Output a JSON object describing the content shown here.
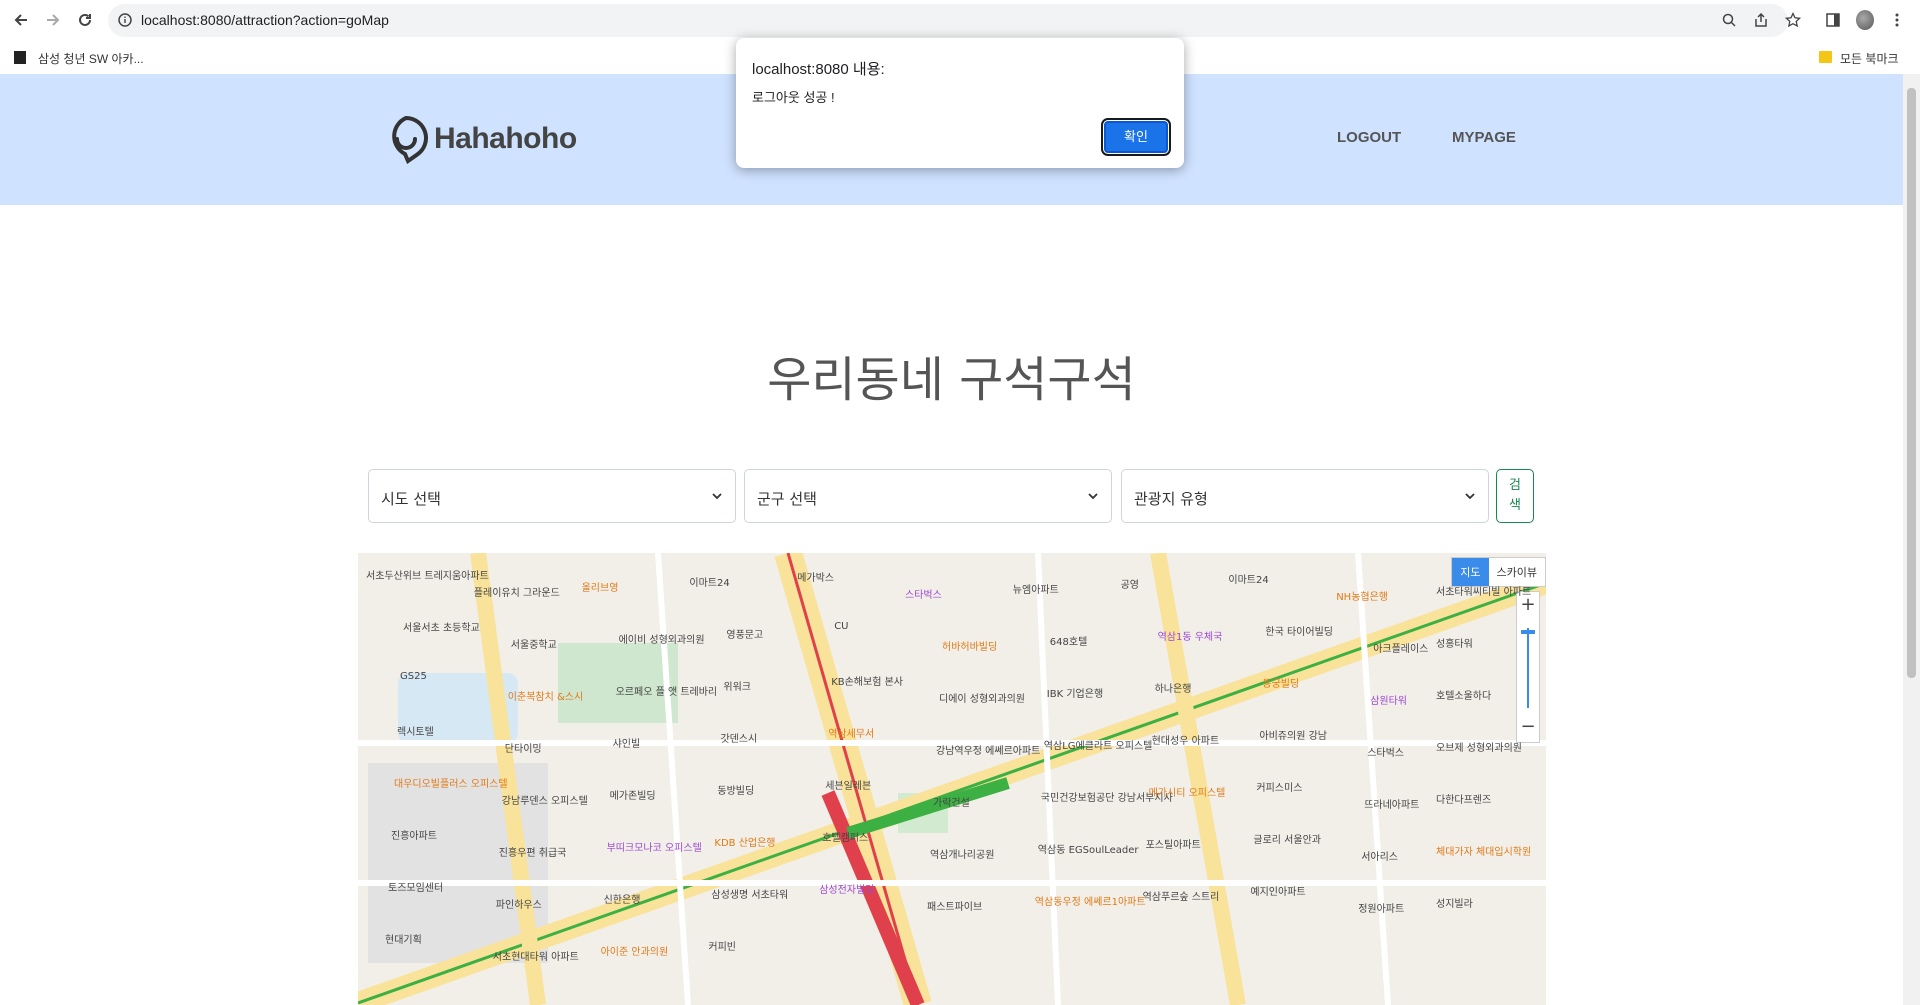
{
  "browser": {
    "url": "localhost:8080/attraction?action=goMap",
    "bookmark_left": "삼성 청년 SW 아카...",
    "bookmark_right": "모든 북마크"
  },
  "dialog": {
    "title": "localhost:8080 내용:",
    "message": "로그아웃 성공 !",
    "ok_label": "확인"
  },
  "header": {
    "logo_text": "Hahahoho",
    "menu": [
      "LOGOUT",
      "MYPAGE"
    ]
  },
  "main": {
    "title": "우리동네 구석구석",
    "filters": {
      "sido": "시도 선택",
      "gugun": "군구 선택",
      "type": "관광지 유형"
    },
    "search_label_1": "검",
    "search_label_2": "색"
  },
  "map": {
    "toggle": [
      "지도",
      "스카이뷰"
    ],
    "zoom_in": "+",
    "zoom_out": "−",
    "labels": [
      "서초두산위브 트레지움아파트",
      "플레이유치 그라운드",
      "올리브영",
      "이마트24",
      "메가박스",
      "스타벅스",
      "뉴엠아파트",
      "공영",
      "이마트24",
      "NH농협은행",
      "서초타워씨티빌 아파트",
      "서울서초 초등학교",
      "서울중학교",
      "에이비 성형외과의원",
      "영풍문고",
      "CU",
      "허바허바빌딩",
      "648호텔",
      "역삼1동 우체국",
      "한국 타이어빌딩",
      "아크플레이스",
      "성홍타워",
      "GS25",
      "이춘복참치 &스시",
      "오르페오 플 앳 트레바리",
      "위워크",
      "KB손해보험 본사",
      "디에이 성형외과의원",
      "IBK 기업은행",
      "하나은행",
      "동궁빌딩",
      "삼원타워",
      "호텔소울하다",
      "렉시토텔",
      "단타이밍",
      "샤인빌",
      "갓덴스시",
      "역삼세무서",
      "강남역우정 에쎄르아파트",
      "역삼LG에클라트 오피스텔",
      "현대성우 아파트",
      "아비쥬의원 강남",
      "스타벅스",
      "오브제 성형외과의원",
      "대우디오빌플러스 오피스텔",
      "강남루덴스 오피스텔",
      "메가존빌딩",
      "동방빌딩",
      "세븐일레븐",
      "가락건설",
      "국민건강보험공단 강남서부지사",
      "메가시티 오피스텔",
      "커피스미스",
      "뜨라네아파트",
      "다한다프렌즈",
      "진흥아파트",
      "진흥우편 취급국",
      "부띠크모나코 오피스텔",
      "KDB 산업은행",
      "호텔캠퍼스",
      "역삼개나리공원",
      "역삼동 EGSoulLeader",
      "포스틸아파트",
      "글로리 서울안과",
      "서아리스",
      "체대가자 체대입시학원",
      "토즈모임센터",
      "파인하우스",
      "신한은행",
      "삼성생명 서초타워",
      "삼성전자빌딩",
      "패스트파이브",
      "역삼동우정 에쎄르1아파트",
      "역삼푸르숲 스트리",
      "예지인아파트",
      "정원아파트",
      "성지빌라",
      "현대기획",
      "서초현대타워 아파트",
      "아이준 안과의원",
      "커피빈"
    ]
  }
}
